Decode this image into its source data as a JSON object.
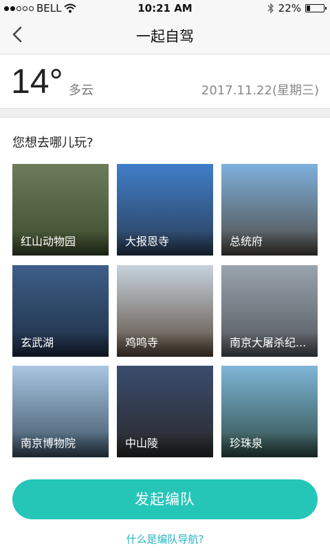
{
  "status_bar": {
    "carrier": "BELL",
    "time": "10:21 AM",
    "battery": "22%",
    "battery_level": 0.22,
    "signal_dots": [
      true,
      true,
      false,
      false,
      false
    ]
  },
  "nav": {
    "title": "一起自驾",
    "back_icon": "chevron-left-icon"
  },
  "weather": {
    "temperature": "14°",
    "condition": "多云",
    "date": "2017.11.22(星期三)"
  },
  "prompt": "您想去哪儿玩?",
  "destinations": [
    {
      "name": "红山动物园",
      "colors": [
        "#6d7d5b",
        "#3b4a2c"
      ]
    },
    {
      "name": "大报恩寺",
      "colors": [
        "#3f7ec9",
        "#2a3d56"
      ]
    },
    {
      "name": "总统府",
      "colors": [
        "#7fb0de",
        "#4d4a43"
      ]
    },
    {
      "name": "玄武湖",
      "colors": [
        "#3d5f88",
        "#1e2d44"
      ]
    },
    {
      "name": "鸡鸣寺",
      "colors": [
        "#c7d3de",
        "#5a4a3c"
      ]
    },
    {
      "name": "南京大屠杀纪...",
      "colors": [
        "#9aa4ad",
        "#50565c"
      ]
    },
    {
      "name": "南京博物院",
      "colors": [
        "#a9c6e2",
        "#3c5264"
      ]
    },
    {
      "name": "中山陵",
      "colors": [
        "#3a4c6e",
        "#2a2a2a"
      ]
    },
    {
      "name": "珍珠泉",
      "colors": [
        "#7fb6d8",
        "#2f4d48"
      ]
    }
  ],
  "cta_label": "发起编队",
  "help_link": "什么是编队导航?",
  "colors": {
    "accent": "#25c6b8",
    "link": "#26b3c4"
  }
}
